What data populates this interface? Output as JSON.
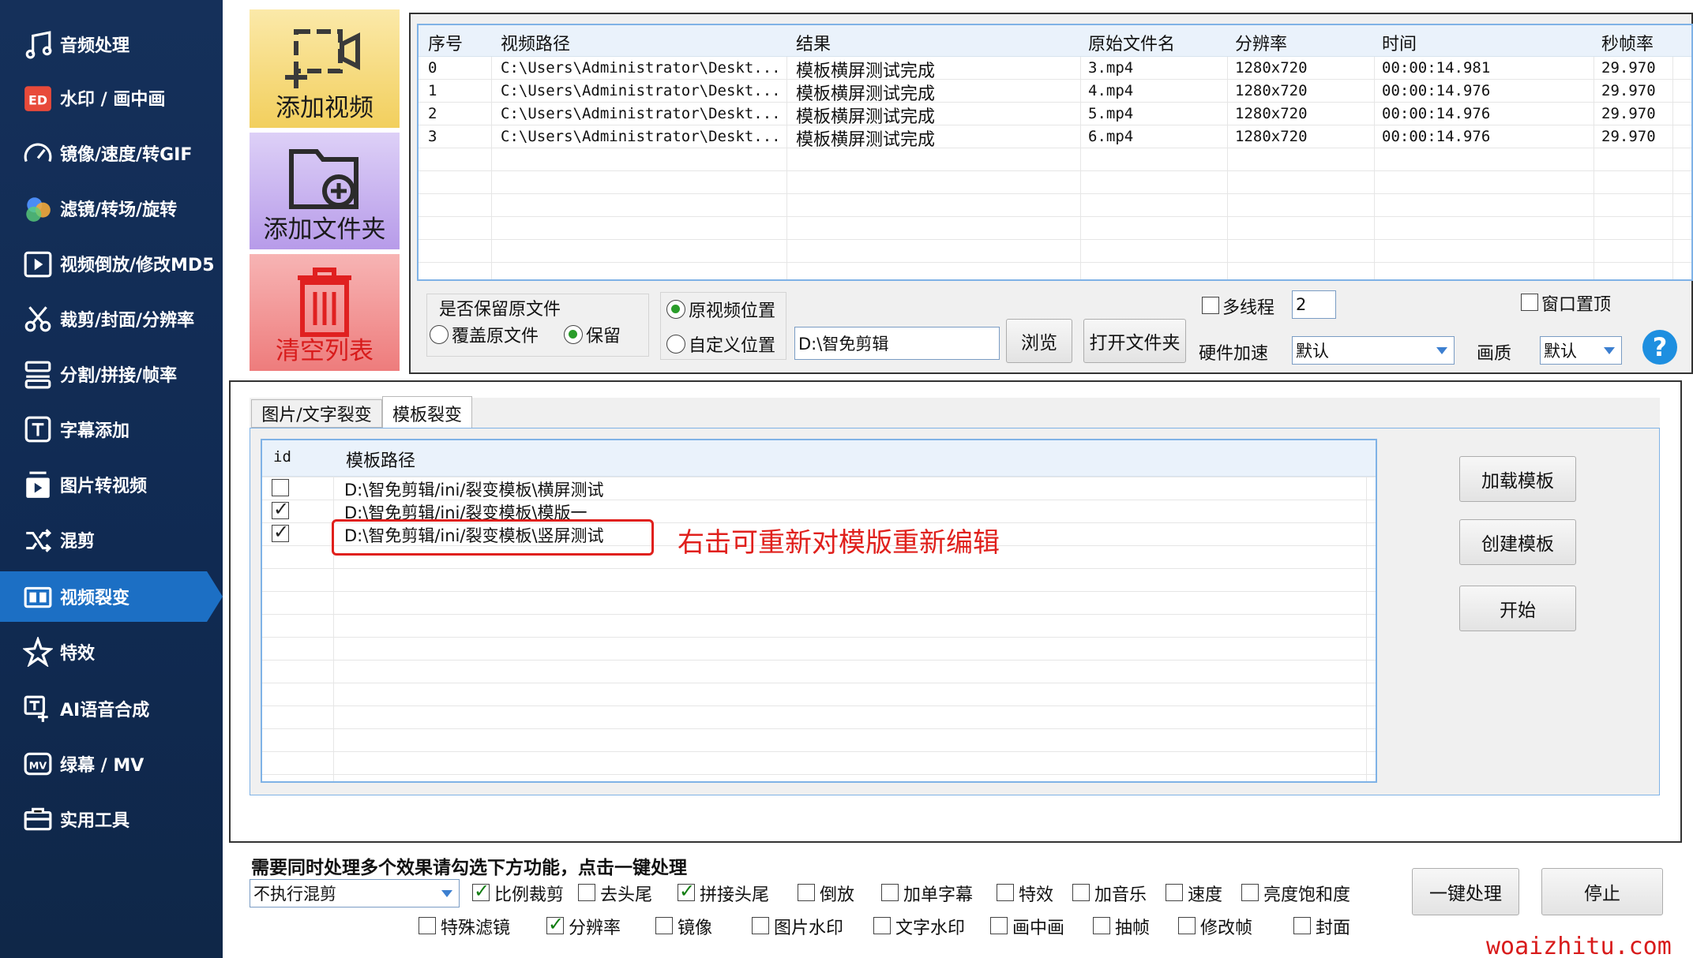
{
  "sidebar": {
    "items": [
      {
        "label": "音频处理",
        "icon": "music-note-icon"
      },
      {
        "label": "水印 / 画中画",
        "icon": "watermark-icon"
      },
      {
        "label": "镜像/速度/转GIF",
        "icon": "speedometer-icon"
      },
      {
        "label": "滤镜/转场/旋转",
        "icon": "filter-circles-icon"
      },
      {
        "label": "视频倒放/修改MD5",
        "icon": "reverse-play-icon"
      },
      {
        "label": "裁剪/封面/分辨率",
        "icon": "scissors-icon"
      },
      {
        "label": "分割/拼接/帧率",
        "icon": "split-icon"
      },
      {
        "label": "字幕添加",
        "icon": "subtitle-icon"
      },
      {
        "label": "图片转视频",
        "icon": "image-to-video-icon"
      },
      {
        "label": "混剪",
        "icon": "shuffle-icon"
      },
      {
        "label": "视频裂变",
        "icon": "video-split-icon",
        "active": true
      },
      {
        "label": "特效",
        "icon": "sparkle-icon"
      },
      {
        "label": "AI语音合成",
        "icon": "tts-icon"
      },
      {
        "label": "绿幕 / MV",
        "icon": "mv-icon"
      },
      {
        "label": "实用工具",
        "icon": "toolbox-icon"
      }
    ]
  },
  "actions": {
    "add_video": "添加视频",
    "add_folder": "添加文件夹",
    "clear_list": "清空列表"
  },
  "file_table": {
    "headers": [
      "序号",
      "视频路径",
      "结果",
      "原始文件名",
      "分辨率",
      "时间",
      "秒帧率"
    ],
    "rows": [
      [
        "0",
        "C:\\Users\\Administrator\\Deskt...",
        "模板横屏测试完成",
        "3.mp4",
        "1280x720",
        "00:00:14.981",
        "29.970"
      ],
      [
        "1",
        "C:\\Users\\Administrator\\Deskt...",
        "模板横屏测试完成",
        "4.mp4",
        "1280x720",
        "00:00:14.976",
        "29.970"
      ],
      [
        "2",
        "C:\\Users\\Administrator\\Deskt...",
        "模板横屏测试完成",
        "5.mp4",
        "1280x720",
        "00:00:14.976",
        "29.970"
      ],
      [
        "3",
        "C:\\Users\\Administrator\\Deskt...",
        "模板横屏测试完成",
        "6.mp4",
        "1280x720",
        "00:00:14.976",
        "29.970"
      ]
    ]
  },
  "options": {
    "keep_original_title": "是否保留原文件",
    "overwrite_label": "覆盖原文件",
    "keep_label": "保留",
    "orig_pos_label": "原视频位置",
    "custom_pos_label": "自定义位置",
    "output_path": "D:\\智免剪辑",
    "browse_label": "浏览",
    "open_folder_label": "打开文件夹",
    "multithread_label": "多线程",
    "thread_count": "2",
    "topmost_label": "窗口置顶",
    "hw_accel_label": "硬件加速",
    "hw_accel_value": "默认",
    "quality_label": "画质",
    "quality_value": "默认",
    "help_glyph": "?"
  },
  "tabs": [
    "图片/文字裂变",
    "模板裂变"
  ],
  "template_table": {
    "headers": [
      "id",
      "模板路径"
    ],
    "rows": [
      {
        "path": "D:\\智免剪辑/ini/裂变模板\\横屏测试",
        "checked": false
      },
      {
        "path": "D:\\智免剪辑/ini/裂变模板\\模版一",
        "checked": true
      },
      {
        "path": "D:\\智免剪辑/ini/裂变模板\\竖屏测试",
        "checked": true
      }
    ],
    "annotation": "右击可重新对模版重新编辑"
  },
  "template_buttons": {
    "load": "加载模板",
    "create": "创建模板",
    "start": "开始"
  },
  "bottom": {
    "hint": "需要同时处理多个效果请勾选下方功能，点击一键处理",
    "mix_select": "不执行混剪",
    "features_row1": [
      {
        "label": "比例裁剪",
        "checked": true
      },
      {
        "label": "去头尾",
        "checked": false
      },
      {
        "label": "拼接头尾",
        "checked": true
      },
      {
        "label": "倒放",
        "checked": false
      },
      {
        "label": "加单字幕",
        "checked": false
      },
      {
        "label": "特效",
        "checked": false
      },
      {
        "label": "加音乐",
        "checked": false
      },
      {
        "label": "速度",
        "checked": false
      },
      {
        "label": "亮度饱和度",
        "checked": false
      }
    ],
    "features_row2": [
      {
        "label": "特殊滤镜",
        "checked": false
      },
      {
        "label": "分辨率",
        "checked": true
      },
      {
        "label": "镜像",
        "checked": false
      },
      {
        "label": "图片水印",
        "checked": false
      },
      {
        "label": "文字水印",
        "checked": false
      },
      {
        "label": "画中画",
        "checked": false
      },
      {
        "label": "抽帧",
        "checked": false
      },
      {
        "label": "修改帧",
        "checked": false
      },
      {
        "label": "封面",
        "checked": false
      }
    ],
    "one_click_label": "一键处理",
    "stop_label": "停止"
  },
  "watermark": "woaizhitu.com",
  "colors": {
    "sidebar_bg": "#15305a",
    "active_item": "#1c6fc4",
    "add_video_bg": "#f6d77a",
    "add_folder_bg": "#c7b2ee",
    "clear_bg": "#f08a8a",
    "annotation_red": "#e0201c"
  }
}
